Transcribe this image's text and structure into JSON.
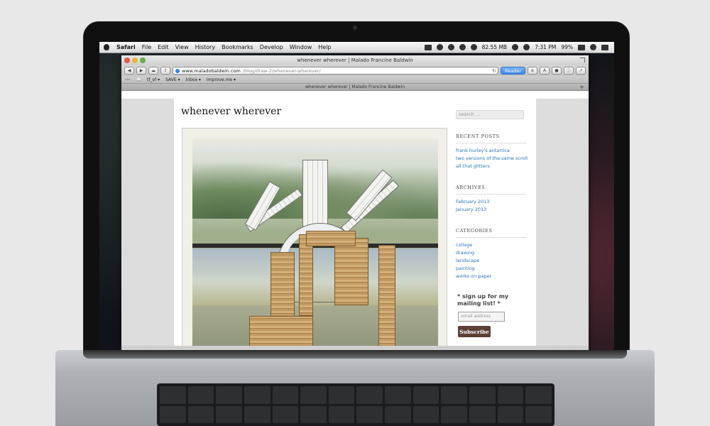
{
  "menubar": {
    "app": "Safari",
    "items": [
      "File",
      "Edit",
      "View",
      "History",
      "Bookmarks",
      "Develop",
      "Window",
      "Help"
    ],
    "memory": "82.55 MB",
    "time": "7:31 PM",
    "battery": "99%"
  },
  "window": {
    "title": "whenever wherever | Malado Francine Baldwin",
    "url_host": "www.maladobaldwin.com",
    "url_path": "/blog/draw-2/whenever-wherever/",
    "reader_label": "Reader",
    "tab_title": "whenever wherever | Malado Francine Baldwin",
    "bookmarks": [
      "tf_of ▾",
      "SAVE ▾",
      "Inbox ▾",
      "Improve.me ▾"
    ]
  },
  "post": {
    "title": "whenever wherever"
  },
  "sidebar": {
    "search_placeholder": "search ...",
    "recent_posts_title": "RECENT POSTS",
    "recent_posts": [
      "frank hurley's antartica",
      "two versions of the same scroll",
      "all that glitters"
    ],
    "archives_title": "ARCHIVES",
    "archives": [
      "February 2013",
      "January 2013"
    ],
    "categories_title": "CATEGORIES",
    "categories": [
      "collage",
      "drawing",
      "landscape",
      "painting",
      "works on paper"
    ],
    "signup_text": "* sign up for my mailing list! *",
    "email_placeholder": "email address",
    "subscribe_label": "Subscribe"
  },
  "colors": {
    "link": "#2b72b6",
    "reader": "#3f84e0",
    "subscribe": "#5b4036"
  }
}
